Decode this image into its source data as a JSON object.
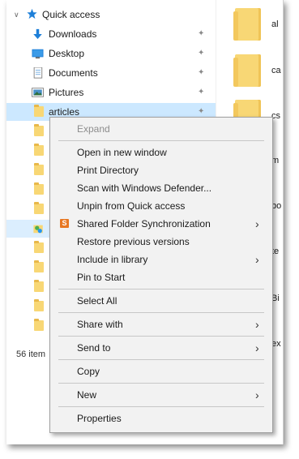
{
  "nav": {
    "quick_access": "Quick access",
    "items": [
      {
        "label": "Downloads",
        "icon": "download-arrow-icon",
        "pinned": true
      },
      {
        "label": "Desktop",
        "icon": "desktop-icon",
        "pinned": true
      },
      {
        "label": "Documents",
        "icon": "documents-icon",
        "pinned": true
      },
      {
        "label": "Pictures",
        "icon": "pictures-icon",
        "pinned": true
      },
      {
        "label": "articles",
        "icon": "folder-icon",
        "pinned": true
      }
    ]
  },
  "content": {
    "visible_labels": [
      "al",
      "ca",
      "cs",
      "m",
      "bo",
      "te",
      "Bi",
      "ex"
    ]
  },
  "status_bar": {
    "item_count": "56 item"
  },
  "context_menu": {
    "items": [
      {
        "label": "Expand",
        "disabled": true
      },
      {
        "label": "Open in new window"
      },
      {
        "label": "Print Directory"
      },
      {
        "label": "Scan with Windows Defender..."
      },
      {
        "label": "Unpin from Quick access"
      },
      {
        "label": "Shared Folder Synchronization",
        "icon": "sync-icon",
        "submenu": true
      },
      {
        "label": "Restore previous versions"
      },
      {
        "label": "Include in library",
        "submenu": true
      },
      {
        "label": "Pin to Start"
      },
      {
        "label": "Select All"
      },
      {
        "label": "Share with",
        "submenu": true
      },
      {
        "label": "Send to",
        "submenu": true
      },
      {
        "label": "Copy"
      },
      {
        "label": "New",
        "submenu": true
      },
      {
        "label": "Properties"
      }
    ]
  },
  "colors": {
    "selection": "#cce8ff",
    "folder": "#f8d775",
    "quick_access_star": "#1e7fd8",
    "menu_background": "#f2f2f2",
    "disabled_text": "#8d8d8d",
    "sync_icon": "#e87722"
  }
}
